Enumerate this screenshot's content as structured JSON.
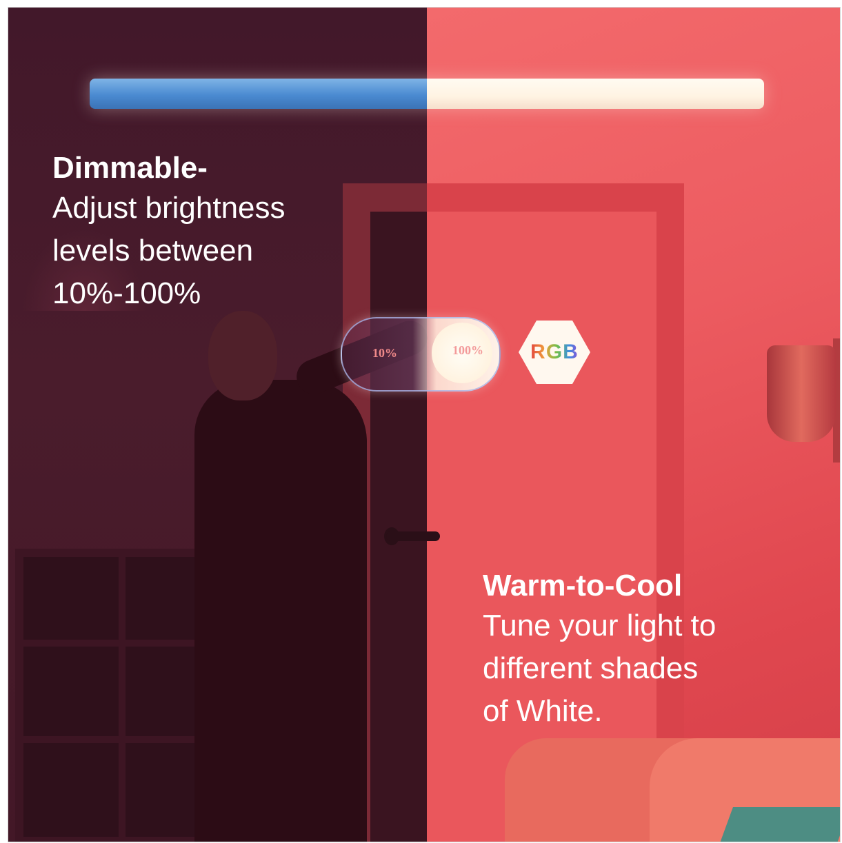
{
  "dimmable": {
    "heading": "Dimmable-",
    "lines": [
      "Adjust brightness",
      "levels between",
      "10%-100%"
    ]
  },
  "slider": {
    "min_label": "10%",
    "max_label": "100%"
  },
  "rgb_badge": "RGB",
  "warm_cool": {
    "heading": "Warm-to-Cool",
    "lines": [
      "Tune your light to",
      "different shades",
      "of White."
    ]
  },
  "colors": {
    "dark_half": "#45192a",
    "warm_half": "#ec5b60",
    "cool_light": "#4a8ad1",
    "warm_light": "#fff3e2"
  }
}
